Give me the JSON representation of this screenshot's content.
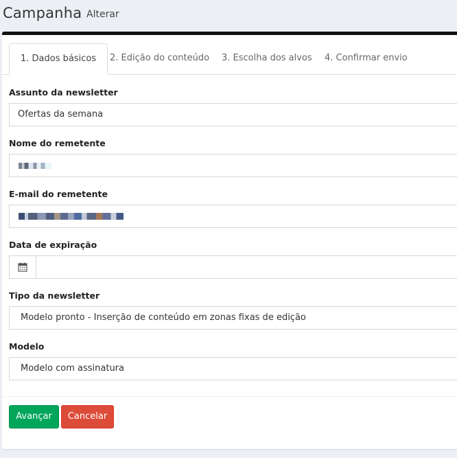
{
  "header": {
    "title": "Campanha",
    "subtitle": "Alterar"
  },
  "tabs": [
    {
      "label": "1. Dados básicos",
      "active": true
    },
    {
      "label": "2. Edição do conteúdo",
      "active": false
    },
    {
      "label": "3. Escolha dos alvos",
      "active": false
    },
    {
      "label": "4. Confirmar envio",
      "active": false
    }
  ],
  "form": {
    "subject": {
      "label": "Assunto da newsletter",
      "value": "Ofertas da semana"
    },
    "sender_name": {
      "label": "Nome do remetente"
    },
    "sender_email": {
      "label": "E-mail do remetente"
    },
    "expiration": {
      "label": "Data de expiração",
      "value": "",
      "icon": "calendar-icon"
    },
    "type": {
      "label": "Tipo da newsletter",
      "value": "Modelo pronto - Inserção de conteúdo em zonas fixas de edição"
    },
    "template": {
      "label": "Modelo",
      "value": "Modelo com assinatura"
    }
  },
  "buttons": {
    "next": "Avançar",
    "cancel": "Cancelar"
  },
  "colors": {
    "success": "#00a65a",
    "danger": "#dd4b39",
    "page_bg": "#ecf0f5"
  }
}
